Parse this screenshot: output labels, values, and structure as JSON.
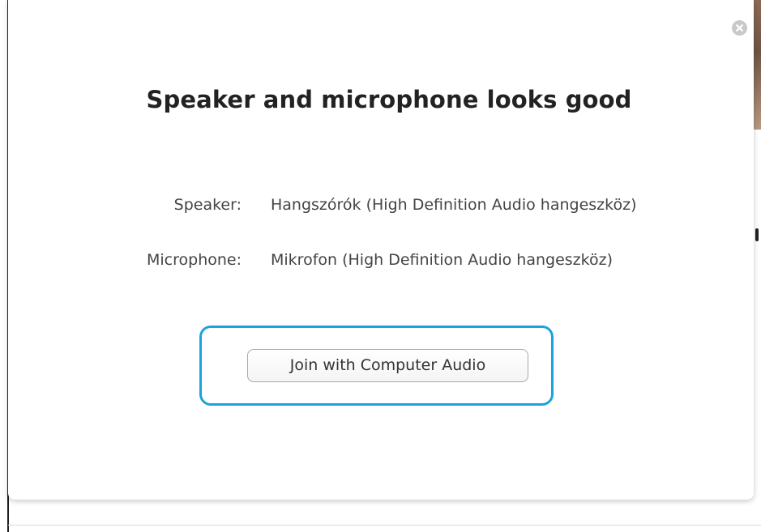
{
  "dialog": {
    "title": "Speaker and microphone looks good",
    "speaker": {
      "label": "Speaker:",
      "value": "Hangszórók (High Definition Audio hangeszköz)"
    },
    "microphone": {
      "label": "Microphone:",
      "value": "Mikrofon (High Definition Audio hangeszköz)"
    },
    "join_button_label": "Join with Computer Audio",
    "close_icon": "close-icon"
  },
  "colors": {
    "focus_ring": "#1aa3dc",
    "title_text": "#222222",
    "body_text": "#444444",
    "close_button": "#c9c9c9"
  }
}
